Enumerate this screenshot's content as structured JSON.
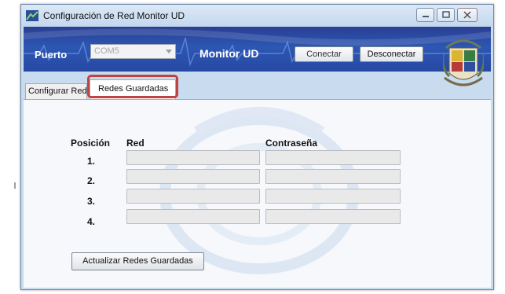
{
  "window": {
    "title": "Configuración de Red Monitor UD",
    "icons": [
      "app-icon",
      "minimize-icon",
      "maximize-icon",
      "close-icon"
    ]
  },
  "header": {
    "port_label": "Puerto",
    "port_value": "COM5",
    "app_label": "Monitor UD",
    "connect_label": "Conectar",
    "disconnect_label": "Desconectar"
  },
  "tabs": [
    {
      "label": "Configurar Red",
      "selected": false
    },
    {
      "label": "Redes Guardadas",
      "selected": true
    }
  ],
  "table": {
    "headers": {
      "position": "Posición",
      "network": "Red",
      "password": "Contraseña"
    },
    "rows": [
      {
        "pos": "1.",
        "red": "",
        "password": ""
      },
      {
        "pos": "2.",
        "red": "",
        "password": ""
      },
      {
        "pos": "3.",
        "red": "",
        "password": ""
      },
      {
        "pos": "4.",
        "red": "",
        "password": ""
      }
    ]
  },
  "refresh_label": "Actualizar Redes Guardadas",
  "colors": {
    "header_blue": "#2c57b3",
    "highlight_red": "#c0433f",
    "window_frame": "#c8dbef"
  }
}
